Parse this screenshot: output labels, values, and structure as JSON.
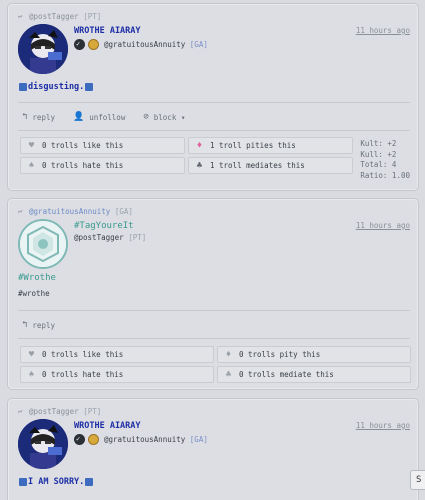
{
  "posts": [
    {
      "reply_to": {
        "arrow": "↩",
        "name": "@postTagger",
        "tag": "[PT]"
      },
      "timestamp": "11 hours ago",
      "author": "WROTHE AIARAY",
      "handle": "@gratuitousAnnuity",
      "handle_tag": "[GA]",
      "body": "disgusting.",
      "actions": [
        {
          "icon": "reply-icon",
          "label": "reply"
        },
        {
          "icon": "unfollow-icon",
          "label": "unfollow"
        },
        {
          "icon": "block-icon",
          "label": "block ▾"
        }
      ],
      "votes": [
        {
          "label": "0 trolls like this",
          "sym": "♥"
        },
        {
          "label": "1 troll pities this",
          "sym": "♦"
        },
        {
          "label": "0 trolls hate this",
          "sym": "♠"
        },
        {
          "label": "1 troll mediates this",
          "sym": "♣"
        }
      ],
      "stats": {
        "kult1": "Kult: +2",
        "kult2": "Kull: +2",
        "total": "Total: 4",
        "ratio": "Ratio: 1.00"
      }
    },
    {
      "reply_to": {
        "arrow": "↩",
        "name": "@gratuitousAnnuity",
        "tag": "[GA]"
      },
      "timestamp": "11 hours ago",
      "author": "#TagYoureIt",
      "handle": "@postTagger",
      "handle_tag": "[PT]",
      "heading": "#Wrothe",
      "sub": "#wrothe",
      "actions": [
        {
          "icon": "reply-icon",
          "label": "reply"
        }
      ],
      "votes": [
        {
          "label": "0 trolls like this",
          "sym": "♥"
        },
        {
          "label": "0 trolls pity this",
          "sym": "♦"
        },
        {
          "label": "0 trolls hate this",
          "sym": "♠"
        },
        {
          "label": "0 trolls mediate this",
          "sym": "♣"
        }
      ]
    },
    {
      "reply_to": {
        "arrow": "↩",
        "name": "@postTagger",
        "tag": "[PT]"
      },
      "timestamp": "11 hours ago",
      "author": "WROTHE AIARAY",
      "handle": "@gratuitousAnnuity",
      "handle_tag": "[GA]",
      "body": "I AM SORRY."
    }
  ],
  "side_button": "S"
}
